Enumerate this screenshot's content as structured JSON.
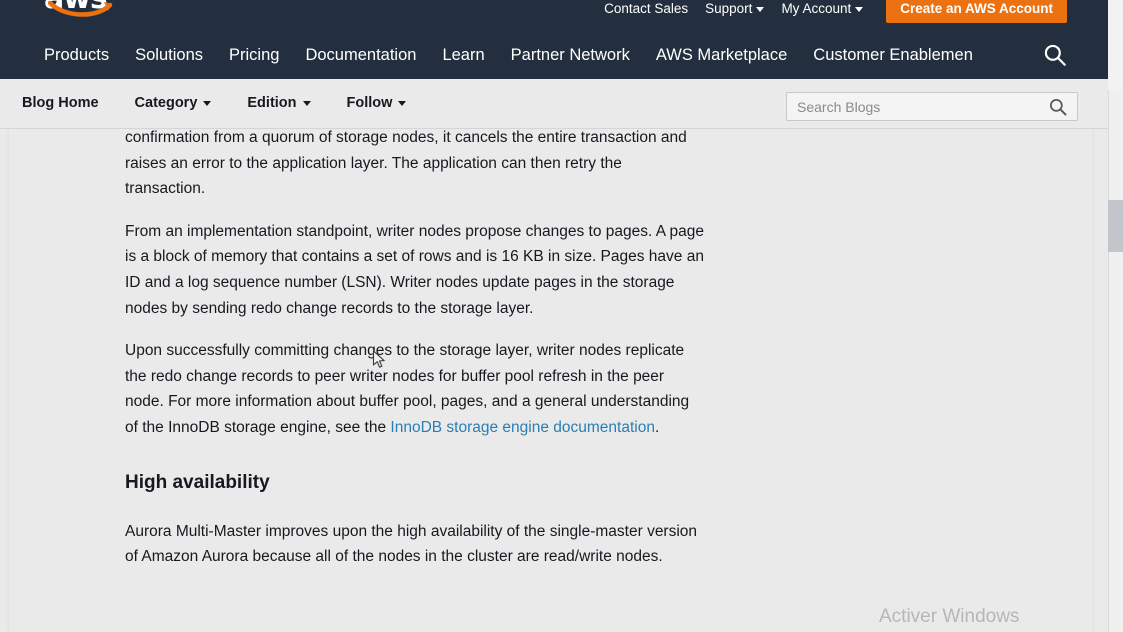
{
  "header": {
    "logo_alt": "aws",
    "utility_links": [
      {
        "label": "Contact Sales",
        "has_caret": false
      },
      {
        "label": "Support",
        "has_caret": true
      },
      {
        "label": "My Account",
        "has_caret": true
      }
    ],
    "create_account_button": "Create an AWS Account",
    "nav_items": [
      "Products",
      "Solutions",
      "Pricing",
      "Documentation",
      "Learn",
      "Partner Network",
      "AWS Marketplace",
      "Customer Enablemen"
    ],
    "search_icon": "search-icon",
    "background_color": "#232f3e",
    "accent_color": "#ec7211"
  },
  "blog_nav": {
    "items": [
      {
        "label": "Blog Home",
        "has_caret": false
      },
      {
        "label": "Category",
        "has_caret": true
      },
      {
        "label": "Edition",
        "has_caret": true
      },
      {
        "label": "Follow",
        "has_caret": true
      }
    ],
    "search": {
      "placeholder": "Search Blogs",
      "value": "",
      "icon": "search-icon"
    },
    "background_color": "#eaeaea"
  },
  "article": {
    "paragraph_1": "confirmation from a quorum of storage nodes, it cancels the entire transaction and raises an error to the application layer. The application can then retry the transaction.",
    "paragraph_2": "From an implementation standpoint, writer nodes propose changes to pages. A page is a block of memory that contains a set of rows and is 16 KB in size. Pages have an ID and a log sequence number (LSN). Writer nodes update pages in the storage nodes by sending redo change records to the storage layer.",
    "paragraph_3_before_link": "Upon successfully committing changes to the storage layer, writer nodes replicate the redo change records to peer writer nodes for buffer pool refresh in the peer node. For more information about buffer pool, pages, and a general understanding of the InnoDB storage engine, see the ",
    "paragraph_3_link": "InnoDB storage engine documentation",
    "paragraph_3_after_link": ".",
    "heading": "High availability",
    "paragraph_4": "Aurora Multi-Master improves upon the high availability of the single-master version of Amazon Aurora because all of the nodes in the cluster are read/write nodes.",
    "link_color": "#2b7eb3",
    "text_color": "#16191f"
  },
  "overlay": {
    "watermark": "Activer Windows"
  },
  "scrollbar": {
    "orientation": "vertical",
    "thumb_position_label": "near-top"
  }
}
